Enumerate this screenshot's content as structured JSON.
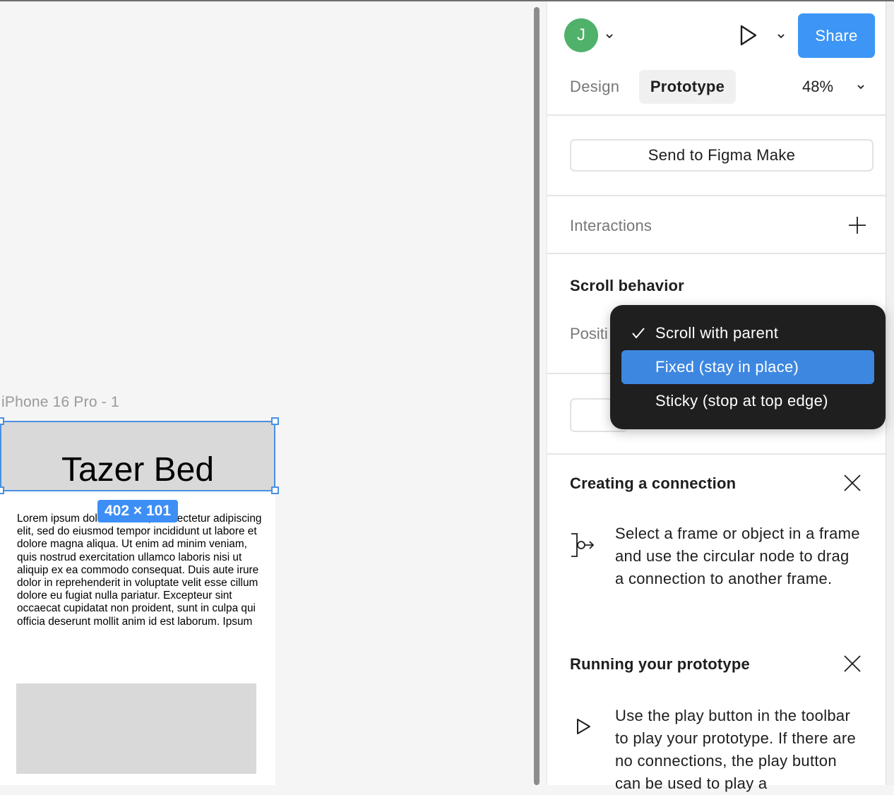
{
  "canvas": {
    "frame_label": "iPhone 16 Pro - 1",
    "header_title": "Tazer Bed",
    "dimension_badge": "402 × 101",
    "lorem": "Lorem ipsum dolor sit amet, consectetur adipiscing elit, sed do eiusmod tempor incididunt ut labore et dolore magna aliqua. Ut enim ad minim veniam, quis nostrud exercitation ullamco laboris nisi ut aliquip ex ea commodo consequat. Duis aute irure dolor in reprehenderit in voluptate velit esse cillum dolore eu fugiat nulla pariatur. Excepteur sint occaecat cupidatat non proident, sunt in culpa qui officia deserunt mollit anim id est laborum. Ipsum"
  },
  "toolbar": {
    "avatar_initial": "J",
    "share_label": "Share",
    "icons": [
      "chevron-down-icon",
      "play-icon"
    ]
  },
  "tabs": {
    "design": "Design",
    "prototype": "Prototype",
    "active": "Prototype",
    "zoom": "48%"
  },
  "panel": {
    "send_button": "Send to Figma Make",
    "interactions_title": "Interactions",
    "scroll_behavior_title": "Scroll behavior",
    "position_label": "Positi",
    "tips": [
      {
        "title": "Creating a connection",
        "icon": "connection-node-icon",
        "text": "Select a frame or object in a frame and use the circular node to drag a connection to another frame."
      },
      {
        "title": "Running your prototype",
        "icon": "play-icon",
        "text": "Use the play button in the toolbar to play your prototype. If there are no connections, the play button can be used to play a"
      }
    ]
  },
  "dropdown": {
    "options": [
      {
        "label": "Scroll with parent",
        "checked": true
      },
      {
        "label": "Fixed (stay in place)",
        "highlighted": true
      },
      {
        "label": "Sticky (stop at top edge)"
      }
    ]
  },
  "colors": {
    "accent": "#3d96f5",
    "selection": "#4a90e2",
    "avatar": "#4fb16a",
    "dropdown_bg": "#1f1f1f",
    "dropdown_highlight": "#3d87e0"
  }
}
